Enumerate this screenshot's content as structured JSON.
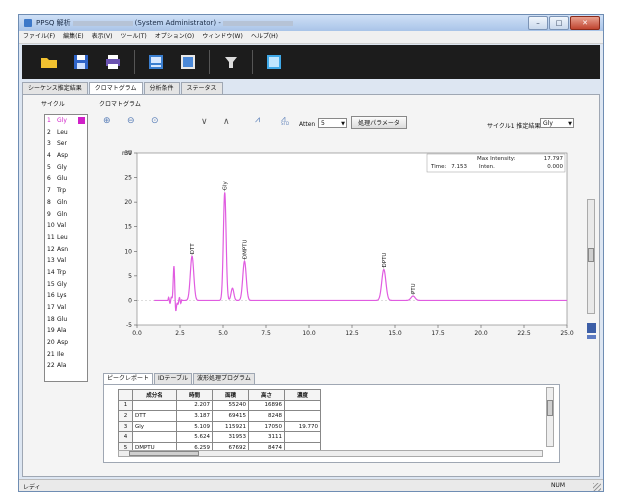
{
  "window": {
    "title_prefix": "PPSQ 解析",
    "title_user": "(System Administrator) -",
    "controls": {
      "minimize": "–",
      "maximize": "□",
      "close": "✕"
    }
  },
  "menu": [
    "ファイル(F)",
    "編集(E)",
    "表示(V)",
    "ツール(T)",
    "オプション(O)",
    "ウィンドウ(W)",
    "ヘルプ(H)"
  ],
  "toolbar": {
    "icons": [
      "folder-open-icon",
      "save-icon",
      "print-icon",
      "report-icon",
      "data-view-icon",
      "filter-icon",
      "monitor-icon"
    ],
    "colors": {
      "folder": "#f2c230",
      "save": "#2f64c8",
      "print": "#6a52b0",
      "report": "#3b7fd0",
      "monitor": "#3fa9e8"
    }
  },
  "tabs": [
    "シーケンス推定結果",
    "クロマトグラム",
    "分析条件",
    "ステータス"
  ],
  "active_tab": 1,
  "cycle_panel": {
    "label": "サイクル",
    "items": [
      {
        "num": "1",
        "aa": "Gly"
      },
      {
        "num": "2",
        "aa": "Leu"
      },
      {
        "num": "3",
        "aa": "Ser"
      },
      {
        "num": "4",
        "aa": "Asp"
      },
      {
        "num": "5",
        "aa": "Gly"
      },
      {
        "num": "6",
        "aa": "Glu"
      },
      {
        "num": "7",
        "aa": "Trp"
      },
      {
        "num": "8",
        "aa": "Gln"
      },
      {
        "num": "9",
        "aa": "Gln"
      },
      {
        "num": "10",
        "aa": "Val"
      },
      {
        "num": "11",
        "aa": "Leu"
      },
      {
        "num": "12",
        "aa": "Asn"
      },
      {
        "num": "13",
        "aa": "Val"
      },
      {
        "num": "14",
        "aa": "Trp"
      },
      {
        "num": "15",
        "aa": "Gly"
      },
      {
        "num": "16",
        "aa": "Lys"
      },
      {
        "num": "17",
        "aa": "Val"
      },
      {
        "num": "18",
        "aa": "Glu"
      },
      {
        "num": "19",
        "aa": "Ala"
      },
      {
        "num": "20",
        "aa": "Asp"
      },
      {
        "num": "21",
        "aa": "Ile"
      },
      {
        "num": "22",
        "aa": "Ala"
      }
    ],
    "selected": 0,
    "highlight_color": "#d020c8"
  },
  "plot_panel": {
    "label": "クロマトグラム",
    "atten_label": "Atten",
    "atten_value": "5",
    "param_button": "処理パラメータ",
    "result_label": "サイクル1 推定結果",
    "result_value": "Gly",
    "tool_icons": [
      "zoom-in-icon",
      "zoom-out-icon",
      "zoom-reset-icon",
      "chevron-down-icon",
      "chevron-up-icon",
      "overlay-icon",
      "std-icon"
    ],
    "std_label": "STD"
  },
  "chart_data": {
    "type": "line",
    "info": {
      "max_intensity_label": "Max Intensity:",
      "max_intensity_value": "17.797",
      "time_label": "Time:",
      "time_value": "7.153",
      "inten_label": "Inten.",
      "inten_value": "0.000"
    },
    "xlim": [
      0,
      25
    ],
    "ylim": [
      -5,
      30
    ],
    "x_ticks": [
      "0.0",
      "2.5",
      "5.0",
      "7.5",
      "10.0",
      "12.5",
      "15.0",
      "17.5",
      "20.0",
      "22.5",
      "25.0"
    ],
    "y_ticks": [
      "-5",
      "0",
      "5",
      "10",
      "15",
      "20",
      "25",
      "30"
    ],
    "y_unit": "mV",
    "line_color": "#e05ce0",
    "peaks": [
      {
        "x": 2.15,
        "height": 7.0,
        "width": 0.05
      },
      {
        "x": 2.25,
        "height": -2.5,
        "width": 0.06
      },
      {
        "x": 3.2,
        "height": 9.0,
        "width": 0.1
      },
      {
        "x": 5.1,
        "height": 22.0,
        "width": 0.08
      },
      {
        "x": 5.55,
        "height": 2.5,
        "width": 0.08
      },
      {
        "x": 6.25,
        "height": 8.0,
        "width": 0.1
      },
      {
        "x": 14.35,
        "height": 6.3,
        "width": 0.12
      },
      {
        "x": 16.05,
        "height": 0.9,
        "width": 0.12
      }
    ],
    "peak_labels": [
      {
        "x": 3.2,
        "y": 9.0,
        "text": "DTT"
      },
      {
        "x": 5.1,
        "y": 22.0,
        "text": "Gly"
      },
      {
        "x": 6.25,
        "y": 8.0,
        "text": "DMPTU"
      },
      {
        "x": 14.35,
        "y": 6.3,
        "text": "DPTU"
      },
      {
        "x": 16.05,
        "y": 0.9,
        "text": "PTU"
      }
    ]
  },
  "sub_tabs": [
    "ピークレポート",
    "IDテーブル",
    "波形処理プログラム"
  ],
  "active_sub_tab": 0,
  "peak_table": {
    "headers": [
      "",
      "成分名",
      "時間",
      "面積",
      "高さ",
      "濃度"
    ],
    "rows": [
      [
        "1",
        "",
        "2.207",
        "55240",
        "16896",
        ""
      ],
      [
        "2",
        "DTT",
        "3.187",
        "69415",
        "8248",
        ""
      ],
      [
        "3",
        "Gly",
        "5.109",
        "115921",
        "17050",
        "19.770"
      ],
      [
        "4",
        "",
        "5.624",
        "31953",
        "3111",
        ""
      ],
      [
        "5",
        "DMPTU",
        "6.259",
        "67692",
        "8474",
        ""
      ]
    ]
  },
  "status": {
    "left": "レディ",
    "right": "NUM"
  }
}
